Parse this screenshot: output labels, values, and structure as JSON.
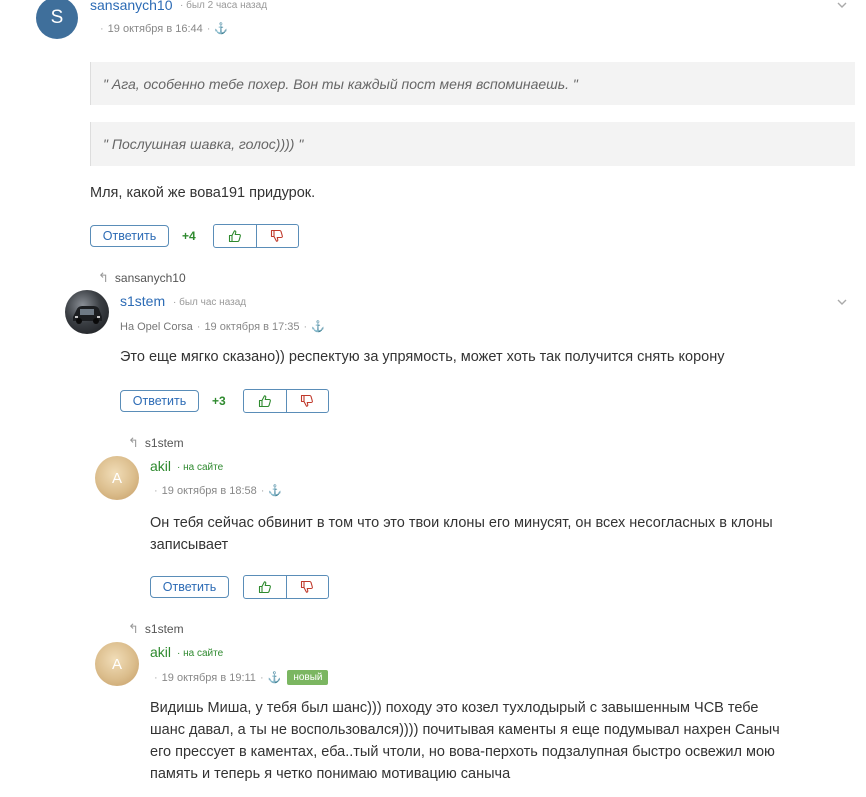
{
  "comments": [
    {
      "avatar_letter": "S",
      "username": "sansanych10",
      "status": "· был 2 часа назад",
      "date": "19 октября в 16:44",
      "quotes": [
        "\" Ага, особенно тебе похер. Вон ты каждый пост меня вспоминаешь. \"",
        "\" Послушная шавка, голос)))) \""
      ],
      "text": "Мля, какой же вова191 придурок.",
      "reply_label": "Ответить",
      "score": "+4"
    },
    {
      "reply_to": "sansanych10",
      "username": "s1stem",
      "status": "· был час назад",
      "car_prefix": "На",
      "car": "Opel Corsa",
      "date": "19 октября в 17:35",
      "text": "Это еще мягко сказано)) респектую за упрямость, может хоть так получится снять корону",
      "reply_label": "Ответить",
      "score": "+3"
    },
    {
      "reply_to": "s1stem",
      "avatar_letter": "A",
      "username": "akil",
      "status": "· на сайте",
      "date": "19 октября в 18:58",
      "text_lines": [
        "Он тебя сейчас обвинит в том что это твои клоны его минусят, он всех несогласных в клоны",
        "записывает"
      ],
      "reply_label": "Ответить"
    },
    {
      "reply_to": "s1stem",
      "avatar_letter": "A",
      "username": "akil",
      "status": "· на сайте",
      "date": "19 октября в 19:11",
      "badge": "новый",
      "text_lines": [
        "Видишь Миша, у тебя был шанс))) походу это козел тухлодырый с завышенным ЧСВ тебе",
        "шанс давал, а ты не воспользовался)))) почитывая каменты я еще подумывал нахрен Саныч",
        "его прессует в каментах, еба..тый чтоли, но вова-перхоть подзалупная быстро освежил мою",
        "память и теперь я четко понимаю мотивацию саныча"
      ]
    }
  ],
  "colors": {
    "link": "#2c6bb5",
    "online": "#2f8a2f",
    "badge": "#7bb661"
  }
}
